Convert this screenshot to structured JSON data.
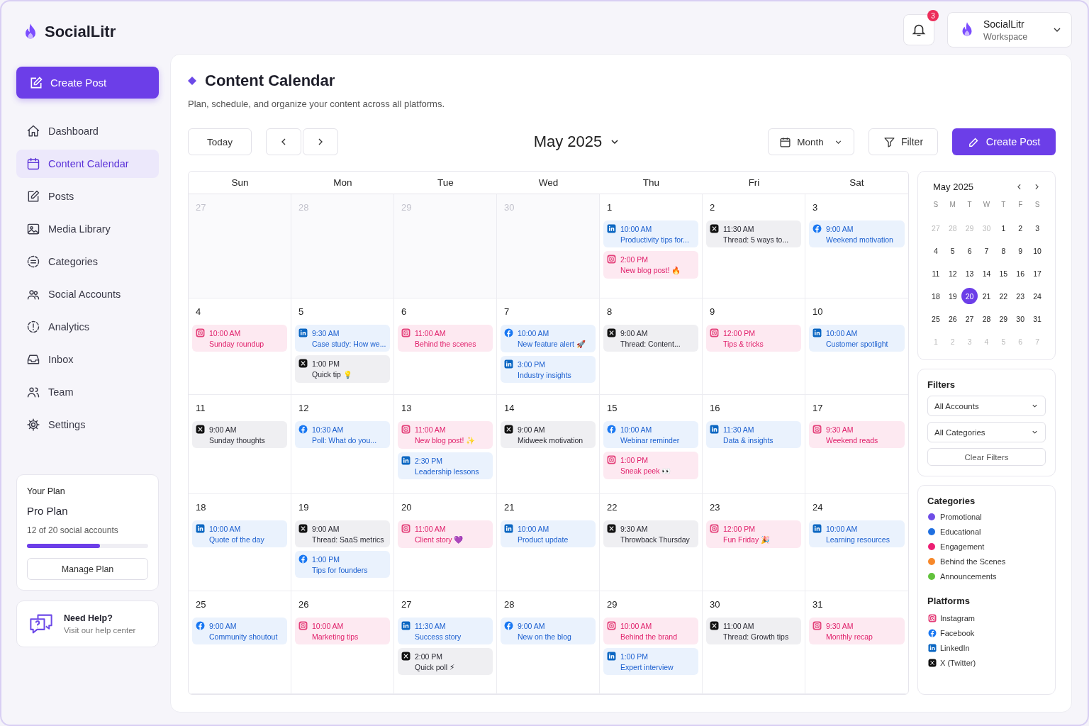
{
  "brand": {
    "name": "SocialLitr"
  },
  "sidebar": {
    "create_button": "Create Post",
    "items": [
      {
        "label": "Dashboard",
        "selected": false
      },
      {
        "label": "Content Calendar",
        "selected": true
      },
      {
        "label": "Posts",
        "selected": false
      },
      {
        "label": "Media Library",
        "selected": false
      },
      {
        "label": "Categories",
        "selected": false
      },
      {
        "label": "Social Accounts",
        "selected": false
      },
      {
        "label": "Analytics",
        "selected": false
      },
      {
        "label": "Inbox",
        "selected": false
      },
      {
        "label": "Team",
        "selected": false
      },
      {
        "label": "Settings",
        "selected": false
      }
    ]
  },
  "plan": {
    "title": "Your Plan",
    "name": "Pro Plan",
    "usage": "12 of 20 social accounts",
    "level": 0.6,
    "button": "Manage Plan"
  },
  "help": {
    "title": "Need Help?",
    "subtitle": "Visit our help center"
  },
  "header": {
    "notification_count": "3",
    "workspace": {
      "name": "SocialLitr",
      "subtitle": "Workspace"
    }
  },
  "page": {
    "title": "Content Calendar",
    "subtitle": "Plan, schedule, and organize your content across all platforms."
  },
  "toolbar": {
    "today": "Today",
    "month": "May 2025",
    "view": "Month",
    "filter": "Filter",
    "create": "Create Post"
  },
  "calendar": {
    "weekdays": [
      "Sun",
      "Mon",
      "Tue",
      "Wed",
      "Thu",
      "Fri",
      "Sat"
    ],
    "weeks": [
      [
        {
          "day": "27",
          "muted": true
        },
        {
          "day": "28",
          "muted": true
        },
        {
          "day": "29",
          "muted": true
        },
        {
          "day": "30",
          "muted": true
        },
        {
          "day": "1",
          "muted": false,
          "posts": [
            {
              "kind": "linkedin",
              "time": "10:00 AM",
              "title": "Productivity tips for..."
            },
            {
              "kind": "instagram",
              "time": "2:00 PM",
              "title": "New blog post! 🔥"
            }
          ]
        },
        {
          "day": "2",
          "muted": false,
          "posts": [
            {
              "kind": "x",
              "time": "11:30 AM",
              "title": "Thread: 5 ways to..."
            }
          ]
        },
        {
          "day": "3",
          "muted": false,
          "posts": [
            {
              "kind": "facebook",
              "time": "9:00 AM",
              "title": "Weekend motivation"
            }
          ]
        }
      ],
      [
        {
          "day": "4",
          "muted": false,
          "posts": [
            {
              "kind": "instagram",
              "time": "10:00 AM",
              "title": "Sunday roundup"
            }
          ]
        },
        {
          "day": "5",
          "muted": false,
          "posts": [
            {
              "kind": "linkedin",
              "time": "9:30 AM",
              "title": "Case study: How we..."
            },
            {
              "kind": "x",
              "time": "1:00 PM",
              "title": "Quick tip 💡"
            }
          ]
        },
        {
          "day": "6",
          "muted": false,
          "posts": [
            {
              "kind": "instagram",
              "time": "11:00 AM",
              "title": "Behind the scenes"
            }
          ]
        },
        {
          "day": "7",
          "muted": false,
          "posts": [
            {
              "kind": "facebook",
              "time": "10:00 AM",
              "title": "New feature alert 🚀"
            },
            {
              "kind": "linkedin",
              "time": "3:00 PM",
              "title": "Industry insights"
            }
          ]
        },
        {
          "day": "8",
          "muted": false,
          "posts": [
            {
              "kind": "x",
              "time": "9:00 AM",
              "title": "Thread: Content..."
            }
          ]
        },
        {
          "day": "9",
          "muted": false,
          "posts": [
            {
              "kind": "instagram",
              "time": "12:00 PM",
              "title": "Tips & tricks"
            }
          ]
        },
        {
          "day": "10",
          "muted": false,
          "posts": [
            {
              "kind": "linkedin",
              "time": "10:00 AM",
              "title": "Customer spotlight"
            }
          ]
        }
      ],
      [
        {
          "day": "11",
          "muted": false,
          "posts": [
            {
              "kind": "x",
              "time": "9:00 AM",
              "title": "Sunday thoughts"
            }
          ]
        },
        {
          "day": "12",
          "muted": false,
          "posts": [
            {
              "kind": "facebook",
              "time": "10:30 AM",
              "title": "Poll: What do you..."
            }
          ]
        },
        {
          "day": "13",
          "muted": false,
          "posts": [
            {
              "kind": "instagram",
              "time": "11:00 AM",
              "title": "New blog post! ✨"
            },
            {
              "kind": "linkedin",
              "time": "2:30 PM",
              "title": "Leadership lessons"
            }
          ]
        },
        {
          "day": "14",
          "muted": false,
          "posts": [
            {
              "kind": "x",
              "time": "9:00 AM",
              "title": "Midweek motivation"
            }
          ]
        },
        {
          "day": "15",
          "muted": false,
          "posts": [
            {
              "kind": "facebook",
              "time": "10:00 AM",
              "title": "Webinar reminder"
            },
            {
              "kind": "instagram",
              "time": "1:00 PM",
              "title": "Sneak peek 👀"
            }
          ]
        },
        {
          "day": "16",
          "muted": false,
          "posts": [
            {
              "kind": "linkedin",
              "time": "11:30 AM",
              "title": "Data & insights"
            }
          ]
        },
        {
          "day": "17",
          "muted": false,
          "posts": [
            {
              "kind": "instagram",
              "time": "9:30 AM",
              "title": "Weekend reads"
            }
          ]
        }
      ],
      [
        {
          "day": "18",
          "muted": false,
          "posts": [
            {
              "kind": "linkedin",
              "time": "10:00 AM",
              "title": "Quote of the day"
            }
          ]
        },
        {
          "day": "19",
          "muted": false,
          "posts": [
            {
              "kind": "x",
              "time": "9:00 AM",
              "title": "Thread: SaaS metrics"
            },
            {
              "kind": "facebook",
              "time": "1:00 PM",
              "title": "Tips for founders"
            }
          ]
        },
        {
          "day": "20",
          "muted": false,
          "posts": [
            {
              "kind": "instagram",
              "time": "11:00 AM",
              "title": "Client story 💜"
            }
          ]
        },
        {
          "day": "21",
          "muted": false,
          "posts": [
            {
              "kind": "linkedin",
              "time": "10:00 AM",
              "title": "Product update"
            }
          ]
        },
        {
          "day": "22",
          "muted": false,
          "posts": [
            {
              "kind": "x",
              "time": "9:30 AM",
              "title": "Throwback Thursday"
            }
          ]
        },
        {
          "day": "23",
          "muted": false,
          "posts": [
            {
              "kind": "instagram",
              "time": "12:00 PM",
              "title": "Fun Friday 🎉"
            }
          ]
        },
        {
          "day": "24",
          "muted": false,
          "posts": [
            {
              "kind": "linkedin",
              "time": "10:00 AM",
              "title": "Learning resources"
            }
          ]
        }
      ],
      [
        {
          "day": "25",
          "muted": false,
          "posts": [
            {
              "kind": "facebook",
              "time": "9:00 AM",
              "title": "Community shoutout"
            }
          ]
        },
        {
          "day": "26",
          "muted": false,
          "posts": [
            {
              "kind": "instagram",
              "time": "10:00 AM",
              "title": "Marketing tips"
            }
          ]
        },
        {
          "day": "27",
          "muted": false,
          "posts": [
            {
              "kind": "linkedin",
              "time": "11:30 AM",
              "title": "Success story"
            },
            {
              "kind": "x",
              "time": "2:00 PM",
              "title": "Quick poll ⚡"
            }
          ]
        },
        {
          "day": "28",
          "muted": false,
          "posts": [
            {
              "kind": "facebook",
              "time": "9:00 AM",
              "title": "New on the blog"
            }
          ]
        },
        {
          "day": "29",
          "muted": false,
          "posts": [
            {
              "kind": "instagram",
              "time": "10:00 AM",
              "title": "Behind the brand"
            },
            {
              "kind": "linkedin",
              "time": "1:00 PM",
              "title": "Expert interview"
            }
          ]
        },
        {
          "day": "30",
          "muted": false,
          "posts": [
            {
              "kind": "x",
              "time": "11:00 AM",
              "title": "Thread: Growth tips"
            }
          ]
        },
        {
          "day": "31",
          "muted": false,
          "posts": [
            {
              "kind": "instagram",
              "time": "9:30 AM",
              "title": "Monthly recap"
            }
          ]
        }
      ]
    ]
  },
  "mini_calendar": {
    "title": "May 2025",
    "weekdays": [
      "S",
      "M",
      "T",
      "W",
      "T",
      "F",
      "S"
    ],
    "weeks": [
      [
        {
          "day": "27",
          "muted": true,
          "selected": false
        },
        {
          "day": "28",
          "muted": true,
          "selected": false
        },
        {
          "day": "29",
          "muted": true,
          "selected": false
        },
        {
          "day": "30",
          "muted": true,
          "selected": false
        },
        {
          "day": "1",
          "muted": false,
          "selected": false
        },
        {
          "day": "2",
          "muted": false,
          "selected": false
        },
        {
          "day": "3",
          "muted": false,
          "selected": false
        }
      ],
      [
        {
          "day": "4",
          "muted": false,
          "selected": false
        },
        {
          "day": "5",
          "muted": false,
          "selected": false
        },
        {
          "day": "6",
          "muted": false,
          "selected": false
        },
        {
          "day": "7",
          "muted": false,
          "selected": false
        },
        {
          "day": "8",
          "muted": false,
          "selected": false
        },
        {
          "day": "9",
          "muted": false,
          "selected": false
        },
        {
          "day": "10",
          "muted": false,
          "selected": false
        }
      ],
      [
        {
          "day": "11",
          "muted": false,
          "selected": false
        },
        {
          "day": "12",
          "muted": false,
          "selected": false
        },
        {
          "day": "13",
          "muted": false,
          "selected": false
        },
        {
          "day": "14",
          "muted": false,
          "selected": false
        },
        {
          "day": "15",
          "muted": false,
          "selected": false
        },
        {
          "day": "16",
          "muted": false,
          "selected": false
        },
        {
          "day": "17",
          "muted": false,
          "selected": false
        }
      ],
      [
        {
          "day": "18",
          "muted": false,
          "selected": false
        },
        {
          "day": "19",
          "muted": false,
          "selected": false
        },
        {
          "day": "20",
          "muted": false,
          "selected": true
        },
        {
          "day": "21",
          "muted": false,
          "selected": false
        },
        {
          "day": "22",
          "muted": false,
          "selected": false
        },
        {
          "day": "23",
          "muted": false,
          "selected": false
        },
        {
          "day": "24",
          "muted": false,
          "selected": false
        }
      ],
      [
        {
          "day": "25",
          "muted": false,
          "selected": false
        },
        {
          "day": "26",
          "muted": false,
          "selected": false
        },
        {
          "day": "27",
          "muted": false,
          "selected": false
        },
        {
          "day": "28",
          "muted": false,
          "selected": false
        },
        {
          "day": "29",
          "muted": false,
          "selected": false
        },
        {
          "day": "30",
          "muted": false,
          "selected": false
        },
        {
          "day": "31",
          "muted": false,
          "selected": false
        }
      ],
      [
        {
          "day": "1",
          "muted": true,
          "selected": false
        },
        {
          "day": "2",
          "muted": true,
          "selected": false
        },
        {
          "day": "3",
          "muted": true,
          "selected": false
        },
        {
          "day": "4",
          "muted": true,
          "selected": false
        },
        {
          "day": "5",
          "muted": true,
          "selected": false
        },
        {
          "day": "6",
          "muted": true,
          "selected": false
        },
        {
          "day": "7",
          "muted": true,
          "selected": false
        }
      ]
    ]
  },
  "filters": {
    "title": "Filters",
    "selects": [
      "All Accounts",
      "All Categories"
    ],
    "clear": "Clear Filters"
  },
  "categories": {
    "title": "Categories",
    "items": [
      {
        "label": "Promotional",
        "color": "#6e4de6"
      },
      {
        "label": "Educational",
        "color": "#1f6fe0"
      },
      {
        "label": "Engagement",
        "color": "#ec1f73"
      },
      {
        "label": "Behind the Scenes",
        "color": "#f7882a"
      },
      {
        "label": "Announcements",
        "color": "#62c23c"
      }
    ]
  },
  "platforms": {
    "title": "Platforms",
    "items": [
      {
        "kind": "instagram",
        "label": "Instagram"
      },
      {
        "kind": "facebook",
        "label": "Facebook"
      },
      {
        "kind": "linkedin",
        "label": "LinkedIn"
      },
      {
        "kind": "x",
        "label": "X (Twitter)"
      }
    ]
  }
}
